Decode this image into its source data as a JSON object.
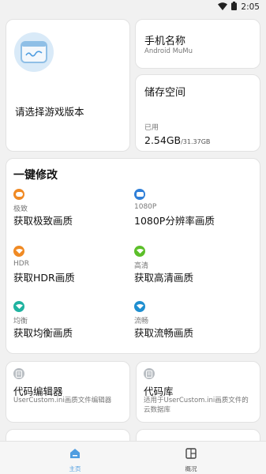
{
  "status_bar": {
    "time": "2:05"
  },
  "version_card": {
    "prompt": "请选择游戏版本"
  },
  "phone_card": {
    "title": "手机名称",
    "device": "Android MuMu"
  },
  "storage_card": {
    "title": "储存空间",
    "used_label": "已用",
    "used": "2.54GB",
    "total": "/31.37GB"
  },
  "modify": {
    "title": "一键修改",
    "options": [
      {
        "label": "极致",
        "action": "获取极致画质",
        "color": "#f08a24"
      },
      {
        "label": "1080P",
        "action": "1080P分辨率画质",
        "color": "#2f7fd8"
      },
      {
        "label": "HDR",
        "action": "获取HDR画质",
        "color": "#f08a24"
      },
      {
        "label": "高清",
        "action": "获取高清画质",
        "color": "#5cbf2a"
      },
      {
        "label": "均衡",
        "action": "获取均衡画质",
        "color": "#1fb3a0"
      },
      {
        "label": "流畅",
        "action": "获取流畅画质",
        "color": "#1f8fd0"
      }
    ]
  },
  "tools": [
    {
      "title": "代码编辑器",
      "desc": "UserCustom.ini画质文件编辑器"
    },
    {
      "title": "代码库",
      "desc": "适用于UserCustom.ini画质文件的云数据库"
    }
  ],
  "bottom_nav": {
    "home": "主页",
    "overview": "概况"
  }
}
